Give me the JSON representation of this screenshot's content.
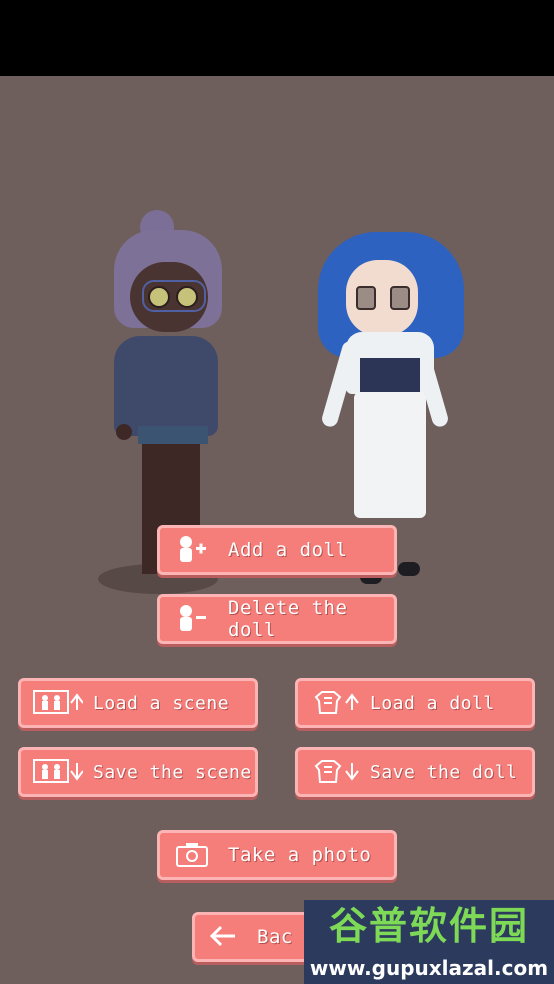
{
  "buttons": {
    "add_doll": {
      "label": "Add a doll",
      "icon": "add-person-icon"
    },
    "delete_doll": {
      "label": "Delete the doll",
      "icon": "remove-person-icon"
    },
    "load_scene": {
      "label": "Load a scene",
      "icon": "scene-upload-icon"
    },
    "load_doll": {
      "label": "Load a doll",
      "icon": "doll-upload-icon"
    },
    "save_scene": {
      "label": "Save the scene",
      "icon": "scene-download-icon"
    },
    "save_doll": {
      "label": "Save the doll",
      "icon": "doll-download-icon"
    },
    "take_photo": {
      "label": "Take a photo",
      "icon": "camera-icon"
    },
    "back": {
      "label": "Bac",
      "icon": "back-arrow-icon"
    }
  },
  "watermark": {
    "chinese": "谷普软件园",
    "url": "www.gupuxlazal.com"
  },
  "colors": {
    "background": "#6e5f5c",
    "button_fill": "#f57e7a",
    "button_border": "#fcb4b4"
  }
}
